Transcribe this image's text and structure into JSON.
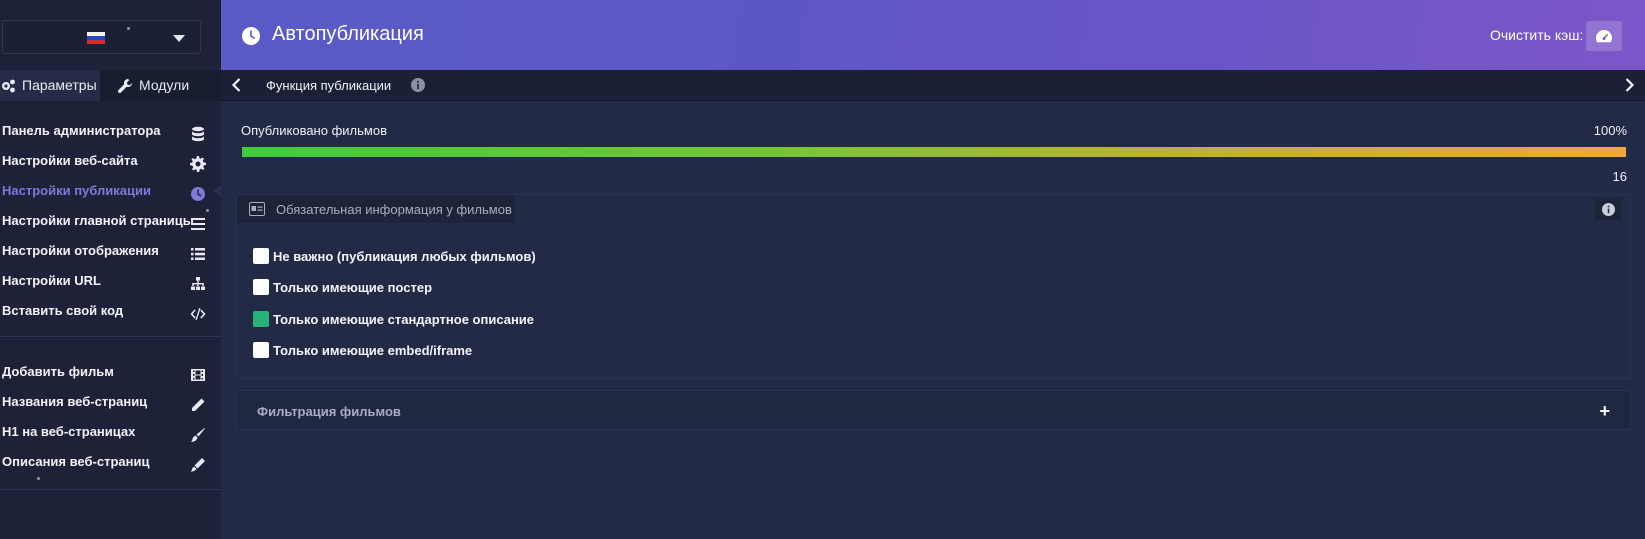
{
  "sidebar": {
    "language": {
      "flag": "ru-flag-icon"
    },
    "tabs": [
      {
        "label": "Параметры",
        "icon": "cogs-icon"
      },
      {
        "label": "Модули",
        "icon": "wrench-icon"
      }
    ],
    "items": [
      {
        "label": "Панель администратора",
        "icon": "database-icon"
      },
      {
        "label": "Настройки веб-сайта",
        "icon": "gear-icon"
      },
      {
        "label": "Настройки публикации",
        "icon": "clock-icon",
        "active": true
      },
      {
        "label": "Настройки главной страницы",
        "icon": "bars-icon"
      },
      {
        "label": "Настройки отображения",
        "icon": "list-icon"
      },
      {
        "label": "Настройки URL",
        "icon": "sitemap-icon"
      },
      {
        "label": "Вставить свой код",
        "icon": "code-icon"
      }
    ],
    "items2": [
      {
        "label": "Добавить фильм",
        "icon": "film-icon"
      },
      {
        "label": "Названия веб-страниц",
        "icon": "pencil-icon"
      },
      {
        "label": "H1 на веб-страницах",
        "icon": "brush-icon"
      },
      {
        "label": "Описания веб-страниц",
        "icon": "marker-icon"
      }
    ]
  },
  "header": {
    "title": "Автопубликация",
    "cache_label": "Очистить кэш:",
    "accent": "#5d57c4"
  },
  "subbar": {
    "label": "Функция публикации"
  },
  "progress": {
    "label": "Опубликовано фильмов",
    "percent_text": "100%",
    "percent": 100,
    "count": "16"
  },
  "required_panel": {
    "title": "Обязательная информация у фильмов",
    "options": [
      {
        "label": "Не важно (публикация любых фильмов)",
        "checked": false
      },
      {
        "label": "Только имеющие постер",
        "checked": false
      },
      {
        "label": "Только имеющие стандартное описание",
        "checked": true
      },
      {
        "label": "Только имеющие embed/iframe",
        "checked": false
      }
    ]
  },
  "filter_panel": {
    "title": "Фильтрация фильмов",
    "toggle": "+"
  }
}
